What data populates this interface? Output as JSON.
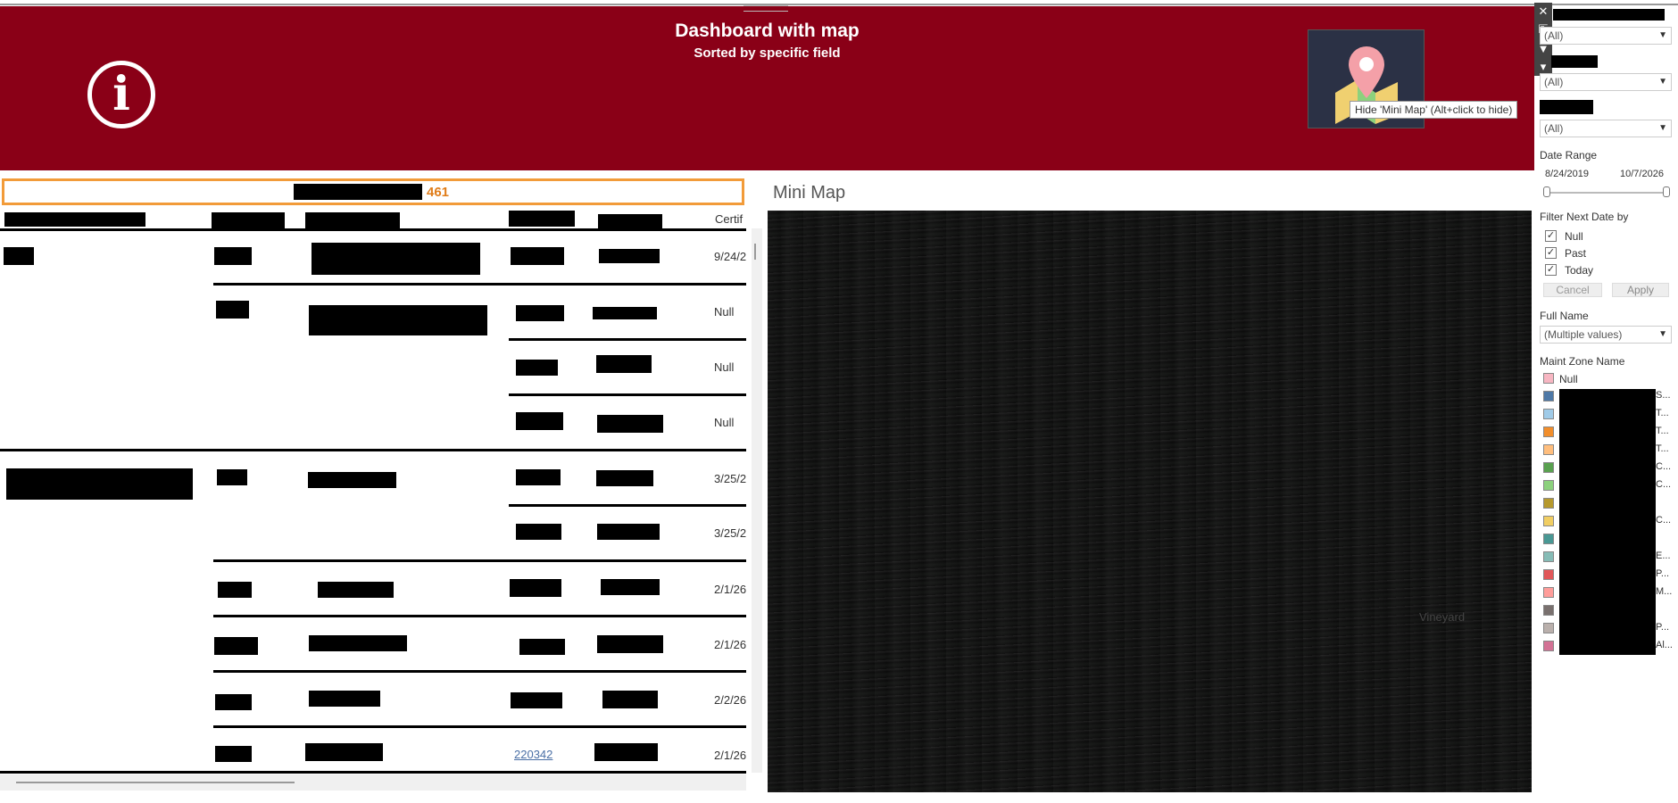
{
  "banner": {
    "title": "Dashboard with map",
    "subtitle": "Sorted by specific field",
    "info_glyph": "i",
    "tooltip": "Hide 'Mini Map' (Alt+click to hide)",
    "background": "#8a0017"
  },
  "toolbar": {
    "close": "✕",
    "popout": "⇱",
    "filter": "▼",
    "more": "▾"
  },
  "summary": {
    "count": "461",
    "accent": "#f29b39"
  },
  "table": {
    "last_header": "Certif",
    "dates": [
      "9/24/2",
      "Null",
      "Null",
      "Null",
      "3/25/2",
      "3/25/2",
      "2/1/26",
      "2/1/26",
      "2/2/26",
      "2/1/26"
    ],
    "link_value": "220342"
  },
  "map": {
    "title": "Mini Map",
    "visible_label": "Vineyard"
  },
  "sidebar": {
    "filter1_value": "(All)",
    "filter2_value": "(All)",
    "filter3_value": "(All)",
    "date_range": {
      "label": "Date Range",
      "start": "8/24/2019",
      "end": "10/7/2026"
    },
    "next_date": {
      "label": "Filter Next Date by",
      "options": [
        {
          "label": "Null",
          "checked": true
        },
        {
          "label": "Past",
          "checked": true
        },
        {
          "label": "Today",
          "checked": true
        }
      ],
      "cancel": "Cancel",
      "apply": "Apply"
    },
    "full_name": {
      "label": "Full Name",
      "value": "(Multiple values)"
    },
    "maint_zone": {
      "label": "Maint Zone Name",
      "null_label": "Null",
      "colors": [
        "#f7b6c2",
        "#4e79a7",
        "#a0cbe8",
        "#f28e2b",
        "#ffbe7d",
        "#59a14f",
        "#8cd17d",
        "#b6992d",
        "#f1ce63",
        "#499894",
        "#86bcb6",
        "#e15759",
        "#ff9d9a",
        "#79706e",
        "#bab0ac",
        "#d37295"
      ],
      "suffixes": [
        "",
        "S...",
        "T...",
        "T...",
        "T...",
        "C...",
        "C...",
        "",
        "C...",
        "",
        "E...",
        "P...",
        "M...",
        "",
        "P...",
        "Al..."
      ]
    }
  }
}
